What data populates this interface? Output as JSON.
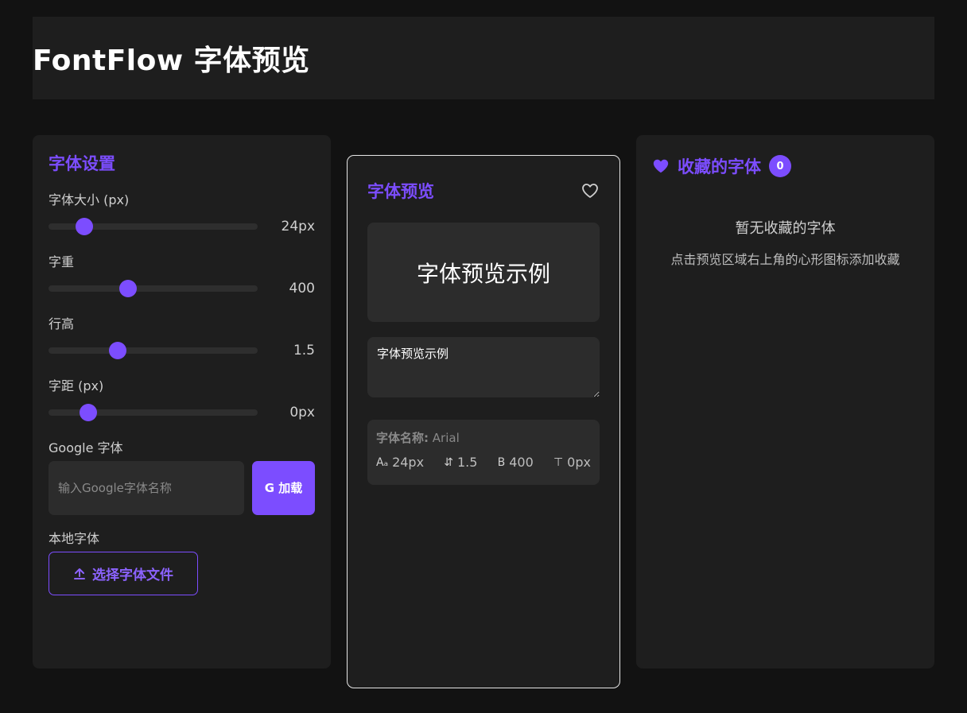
{
  "header": {
    "title": "FontFlow 字体预览"
  },
  "settings": {
    "title": "字体设置",
    "sliders": [
      {
        "label": "字体大小 (px)",
        "value_text": "24px",
        "fraction": 0.17
      },
      {
        "label": "字重",
        "value_text": "400",
        "fraction": 0.38
      },
      {
        "label": "行高",
        "value_text": "1.5",
        "fraction": 0.33
      },
      {
        "label": "字距 (px)",
        "value_text": "0px",
        "fraction": 0.19
      }
    ],
    "google": {
      "label": "Google 字体",
      "placeholder": "输入Google字体名称",
      "button": "G 加载"
    },
    "local": {
      "label": "本地字体",
      "button": "选择字体文件"
    }
  },
  "preview": {
    "title": "字体预览",
    "sample_text": "字体预览示例",
    "textarea_value": "字体预览示例",
    "info": {
      "font_name_label": "字体名称:",
      "font_name": "Arial",
      "size": "24px",
      "line_height": "1.5",
      "weight": "400",
      "spacing": "0px"
    }
  },
  "favorites": {
    "title": "收藏的字体",
    "count": "0",
    "empty_title": "暂无收藏的字体",
    "empty_desc": "点击预览区域右上角的心形图标添加收藏"
  },
  "colors": {
    "accent": "#7c4dff",
    "background": "#121212",
    "panel": "#1e1e1e"
  }
}
